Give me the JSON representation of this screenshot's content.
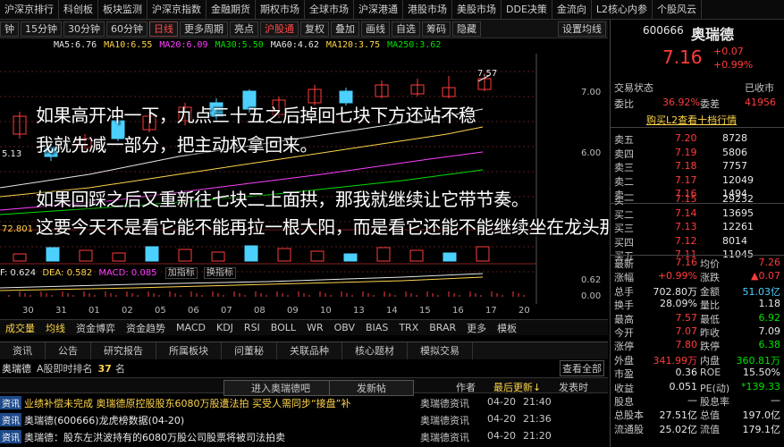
{
  "topnav": {
    "items": [
      "沪深京排行",
      "科创板",
      "板块监测",
      "沪深京指数",
      "金融期货",
      "期权市场",
      "全球市场",
      "沪深港通",
      "港股市场",
      "美股市场",
      "DDE决策",
      "金流向",
      "L2核心内参",
      "个股风云"
    ]
  },
  "toolbar": {
    "items": [
      "钟",
      "15分钟",
      "30分钟",
      "60分钟",
      "日线",
      "更多周期",
      "亮点",
      "复权",
      "叠加",
      "画线",
      "自选",
      "筹码",
      "隐藏"
    ],
    "active": "日线",
    "extra": "沪股通",
    "settings": "设置均线"
  },
  "ma": [
    {
      "label": "MA5:6.76",
      "color": "#e8e8e8"
    },
    {
      "label": "MA10:6.55",
      "color": "#ffd54a"
    },
    {
      "label": "MA20:6.09",
      "color": "#ff40ff"
    },
    {
      "label": "MA30:5.50",
      "color": "#00e000"
    },
    {
      "label": "MA60:4.62",
      "color": "#e8e8e8"
    },
    {
      "label": "MA120:3.75",
      "color": "#ffd54a"
    },
    {
      "label": "MA250:3.62",
      "color": "#00e000"
    }
  ],
  "chart": {
    "high_label": "7.57",
    "low_label": "5.13",
    "vol_label": "72.801",
    "price_ticks": [
      "7.00",
      "6.00"
    ],
    "vol_ticks": [],
    "macd_ticks": [
      "0.62",
      "0.00"
    ],
    "dif": "F: 0.624",
    "dea": "DEA: 0.582",
    "macd": "MACD: 0.085",
    "btn_add": "加指标",
    "btn_switch": "换指标"
  },
  "caption": {
    "line1": "如果高开冲一下，九点三十五之后掉回七块下方还站不稳",
    "line2": "我就先减一部分，把主动权拿回来。",
    "line3": "如果回踩之后又重新往七块二上面拱，那我就继续让它带节奏。",
    "line4": "这要今天不是看它能不能再拉一根大阳，而是看它还能不能继续坐在龙头那把椅子上"
  },
  "xaxis": [
    "30",
    "31",
    "01",
    "02",
    "05",
    "06",
    "07",
    "08",
    "09",
    "10",
    "13",
    "14",
    "15",
    "16",
    "17",
    "20"
  ],
  "indtabs": {
    "items": [
      "成交量",
      "均线",
      "资金博弈",
      "资金趋势",
      "MACD",
      "KDJ",
      "RSI",
      "BOLL",
      "WR",
      "OBV",
      "BIAS",
      "TRX",
      "BRAR",
      "更多",
      "模板"
    ]
  },
  "news": {
    "tabs": [
      "资讯",
      "公告",
      "研究报告",
      "所属板块",
      "问董秘",
      "关联品种",
      "核心题材",
      "模拟交易"
    ],
    "stock": "奥瑞德",
    "rank_label": "A股即时排名",
    "rank": "37",
    "rank_unit": "名",
    "enter_bar": "进入奥瑞德吧",
    "post": "发新帖",
    "author": "作者",
    "latest": "最后更新↓",
    "reply": "发表时",
    "view_all": "查看全部",
    "rows": [
      {
        "tag": "资讯",
        "title": "业绩补偿未完成 奥瑞德原控股股东6080万股遭法拍 买受人需同步“接盘”补",
        "src": "奥瑞德资讯",
        "date": "04-20",
        "time": "21:40"
      },
      {
        "tag": "资讯",
        "title": "奥瑞德(600666)龙虎榜数据(04-20)",
        "src": "奥瑞德资讯",
        "date": "04-20",
        "time": "21:36"
      },
      {
        "tag": "资讯",
        "title": "奥瑞德：股东左洪波持有的6080万股公司股票将被司法拍卖",
        "src": "奥瑞德资讯",
        "date": "04-20",
        "time": "21:20"
      }
    ]
  },
  "quote": {
    "code": "600666",
    "name": "奥瑞德",
    "price": "7.16",
    "change": "+0.07",
    "pct": "+0.99%",
    "status_label": "交易状态",
    "status": "已收市",
    "weibi_label": "委比",
    "weibi": "36.92%",
    "weicha_label": "委差",
    "weicha": "41956",
    "l2": "购买L2查看十档行情",
    "sell": [
      {
        "l": "卖五",
        "p": "7.20",
        "v": "8728"
      },
      {
        "l": "卖四",
        "p": "7.19",
        "v": "5806"
      },
      {
        "l": "卖三",
        "p": "7.18",
        "v": "7757"
      },
      {
        "l": "卖二",
        "p": "7.17",
        "v": "12049"
      },
      {
        "l": "卖一",
        "p": "7.16",
        "v": "1494"
      }
    ],
    "buy": [
      {
        "l": "买一",
        "p": "7.15",
        "v": "29232"
      },
      {
        "l": "买二",
        "p": "7.14",
        "v": "13695"
      },
      {
        "l": "买三",
        "p": "7.13",
        "v": "12261"
      },
      {
        "l": "买四",
        "p": "7.12",
        "v": "8014"
      },
      {
        "l": "买五",
        "p": "7.11",
        "v": "11045"
      }
    ],
    "stats": [
      [
        "最新",
        "7.16",
        "均价",
        "7.26"
      ],
      [
        "涨幅",
        "+0.99%",
        "涨跌",
        "▲0.07"
      ],
      [
        "总手",
        "702.80万",
        "金额",
        "51.03亿"
      ],
      [
        "换手",
        "28.09%",
        "量比",
        "1.18"
      ],
      [
        "最高",
        "7.57",
        "最低",
        "6.92"
      ],
      [
        "今开",
        "7.07",
        "昨收",
        "7.09"
      ],
      [
        "涨停",
        "7.80",
        "跌停",
        "6.38"
      ],
      [
        "外盘",
        "341.99万",
        "内盘",
        "360.81万"
      ],
      [
        "市盈",
        "0.36",
        "ROE",
        "15.50%"
      ],
      [
        "收益",
        "0.051",
        "PE(动)",
        "*139.33"
      ],
      [
        "股息",
        "—",
        "股息率",
        "—"
      ],
      [
        "总股本",
        "27.51亿",
        "总值",
        "197.0亿"
      ],
      [
        "流通股",
        "25.02亿",
        "流值",
        "179.1亿"
      ]
    ]
  }
}
